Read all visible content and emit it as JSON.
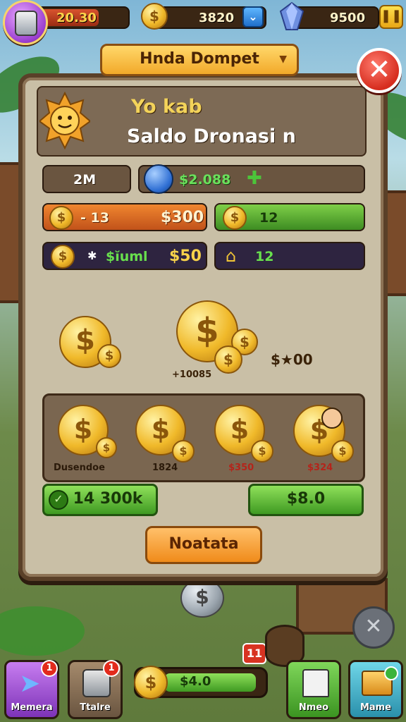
{
  "topbar": {
    "energy_value": "20.30",
    "coins_value": "3820",
    "gems_value": "9500",
    "dropdown_icon": "chevron-down-icon",
    "pause_icon": "pause-icon"
  },
  "dialog": {
    "title": "Hnda Dompet",
    "close_label": "✕",
    "header": {
      "name": "Yo kab",
      "subtitle": "Saldo Dronasi n"
    },
    "summary": {
      "left_value": "2M",
      "mid_value": "$2.088"
    },
    "row1": {
      "left_label": "- 13",
      "left_value": "$300",
      "right_value": "12"
    },
    "row2": {
      "label": "$ĭuml",
      "value": "$50",
      "right_value": "12"
    },
    "big_coins": {
      "left_caption": "",
      "center_caption": "+10085",
      "right_value": "$★00"
    },
    "coin_cards": [
      {
        "caption": "Dusendoe"
      },
      {
        "caption": "1824"
      },
      {
        "caption": "$350"
      },
      {
        "caption": "$324"
      }
    ],
    "action_left": "14 300k",
    "action_right": "$8.0",
    "primary_button": "Noatata"
  },
  "bottom_bar": {
    "coin_value": "$4.0",
    "notification_count": "11",
    "items": [
      {
        "label": "Memera",
        "badge": "1"
      },
      {
        "label": "Ttalre",
        "badge": "1"
      },
      {
        "label": "Nmeo",
        "badge": ""
      },
      {
        "label": "Mame",
        "badge": ""
      }
    ]
  },
  "colors": {
    "panel": "#c9bfa6",
    "frame": "#5a4028",
    "accent_gold": "#f0b92a",
    "green": "#3f9a22",
    "orange": "#f08b1a",
    "close_red": "#d62d1f"
  }
}
